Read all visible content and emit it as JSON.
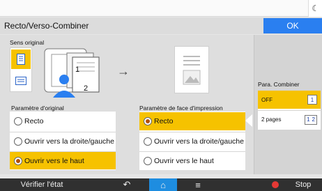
{
  "header": {
    "title": "Recto/Verso-Combiner",
    "ok_label": "OK"
  },
  "sens_original": {
    "label": "Sens original",
    "options": [
      {
        "icon": "portrait-page-icon",
        "selected": true
      },
      {
        "icon": "landscape-page-icon",
        "selected": false
      }
    ]
  },
  "illustration": {
    "page_num_1": "1",
    "page_num_2": "2"
  },
  "parametre_original": {
    "label": "Paramètre d'original",
    "options": [
      {
        "label": "Recto",
        "selected": false
      },
      {
        "label": "Ouvrir vers la droite/gauche",
        "selected": false
      },
      {
        "label": "Ouvrir vers le haut",
        "selected": true
      }
    ]
  },
  "parametre_face": {
    "label": "Paramètre de face d'impression",
    "options": [
      {
        "label": "Recto",
        "selected": true
      },
      {
        "label": "Ouvrir vers la droite/gauche",
        "selected": false
      },
      {
        "label": "Ouvrir vers le haut",
        "selected": false
      }
    ]
  },
  "para_combiner": {
    "label": "Para. Combiner",
    "options": [
      {
        "label": "OFF",
        "box": "1",
        "selected": true
      },
      {
        "label": "2 pages",
        "box_a": "1",
        "box_b": "2",
        "selected": false
      }
    ]
  },
  "bottom_bar": {
    "verify_label": "Vérifier l'état",
    "stop_label": "Stop"
  },
  "colors": {
    "accent_blue": "#2a7ff0",
    "selected_yellow": "#f6c200",
    "home_blue": "#1e8de0",
    "stop_red": "#e53935",
    "bar_dark": "#303030"
  }
}
